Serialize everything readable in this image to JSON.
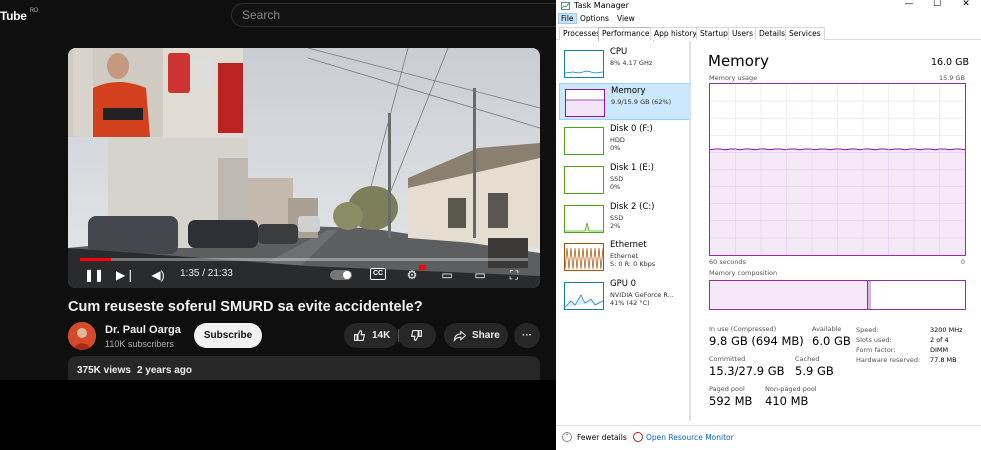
{
  "youtube": {
    "logo_text": "Tube",
    "logo_country": "RO",
    "search_placeholder": "Search",
    "player": {
      "time": "1:35 / 21:33",
      "progress": 0.07
    },
    "video_title": "Cum reuseste soferul SMURD sa evite accidentele?",
    "channel_name": "Dr. Paul Oarga",
    "subscribers": "110K subscribers",
    "subscribe_label": "Subscribe",
    "likes": "14K",
    "share_label": "Share",
    "more_label": "···",
    "views": "375K views",
    "posted": "2 years ago"
  },
  "taskmanager": {
    "window_title": "Task Manager",
    "window_buttons": {
      "minimize": "—",
      "maximize": "☐",
      "close": "✕"
    },
    "menu": [
      "File",
      "Options",
      "View"
    ],
    "tabs": [
      "Processes",
      "Performance",
      "App history",
      "Startup",
      "Users",
      "Details",
      "Services"
    ],
    "active_tab": "Performance",
    "sidebar": [
      {
        "name": "CPU",
        "sub1": "8%  4.17 GHz",
        "sub2": "",
        "color": "#117dbb"
      },
      {
        "name": "Memory",
        "sub1": "9.9/15.9 GB (62%)",
        "sub2": "",
        "color": "#8b12ae"
      },
      {
        "name": "Disk 0 (F:)",
        "sub1": "HDD",
        "sub2": "0%",
        "color": "#4da60c"
      },
      {
        "name": "Disk 1 (E:)",
        "sub1": "SSD",
        "sub2": "0%",
        "color": "#4da60c"
      },
      {
        "name": "Disk 2 (C:)",
        "sub1": "SSD",
        "sub2": "2%",
        "color": "#4da60c"
      },
      {
        "name": "Ethernet",
        "sub1": "Ethernet",
        "sub2": "S: 0  R: 0 Kbps",
        "color": "#a74f01"
      },
      {
        "name": "GPU 0",
        "sub1": "NVIDIA GeForce R...",
        "sub2": "41%  (42 °C)",
        "color": "#117dbb"
      }
    ],
    "memory": {
      "heading": "Memory",
      "total": "16.0 GB",
      "usage_label": "Memory usage",
      "usage_max": "15.9 GB",
      "axis_left": "60 seconds",
      "axis_right": "0",
      "composition_label": "Memory composition",
      "usage_fraction": 0.62,
      "in_use_label": "In use (Compressed)",
      "in_use_value": "9.8 GB (694 MB)",
      "available_label": "Available",
      "available_value": "6.0 GB",
      "committed_label": "Committed",
      "committed_value": "15.3/27.9 GB",
      "cached_label": "Cached",
      "cached_value": "5.9 GB",
      "paged_label": "Paged pool",
      "paged_value": "592 MB",
      "nonpaged_label": "Non-paged pool",
      "nonpaged_value": "410 MB",
      "speed_label": "Speed:",
      "speed_value": "3200 MHz",
      "slots_label": "Slots used:",
      "slots_value": "2 of 4",
      "form_label": "Form factor:",
      "form_value": "DIMM",
      "hwres_label": "Hardware reserved:",
      "hwres_value": "77.8 MB"
    },
    "footer": {
      "fewer_details": "Fewer details",
      "open_monitor": "Open Resource Monitor"
    }
  }
}
